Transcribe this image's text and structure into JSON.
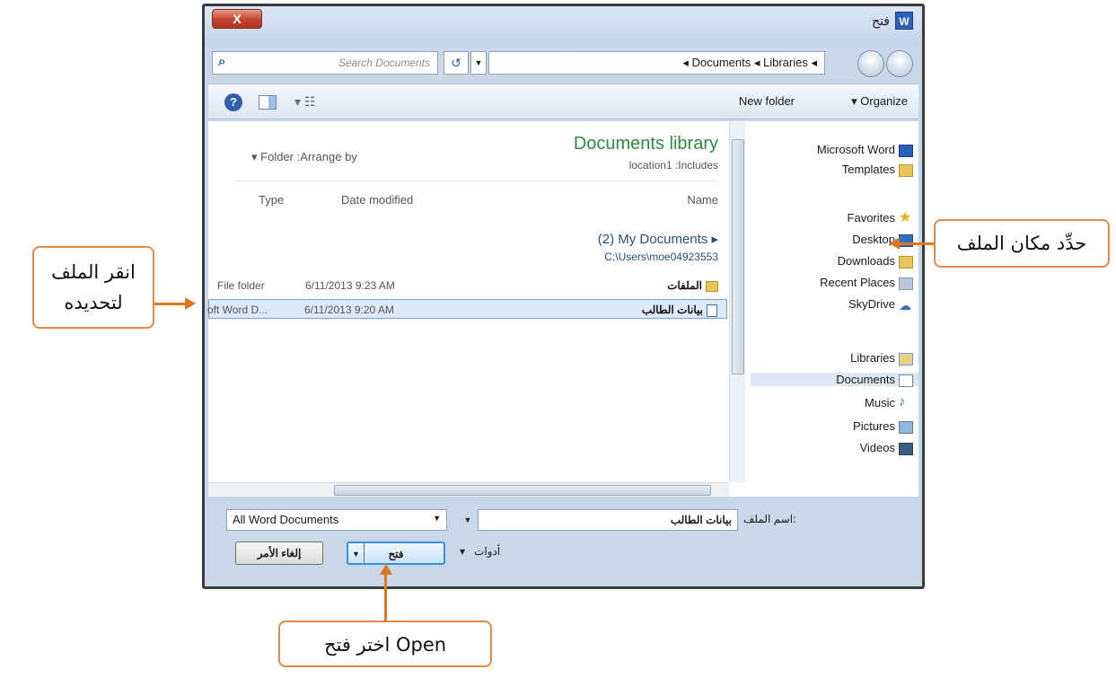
{
  "window": {
    "title": "فتح",
    "close_label": "X",
    "app_icon_letter": "W"
  },
  "address_bar": {
    "search_placeholder": "Search Documents",
    "breadcrumb": "◂ Documents ◂ Libraries ◂"
  },
  "toolbar": {
    "new_folder": "New folder",
    "organize": "▾ Organize"
  },
  "file_pane": {
    "arrange_by": "▾ Folder   :Arrange by",
    "library_title": "Documents library",
    "library_includes": "location1  :Includes",
    "columns": {
      "type": "Type",
      "date_modified": "Date modified",
      "name": "Name"
    },
    "group": {
      "title": "(2) My Documents ▸",
      "path": "C:\\Users\\moe04923553"
    },
    "rows": [
      {
        "type": "File folder",
        "date": "6/11/2013 9:23 AM",
        "name": "الملفات"
      },
      {
        "type": "oft Word D...",
        "date": "6/11/2013 9:20 AM",
        "name": "بيانات الطالب"
      }
    ]
  },
  "nav_pane": {
    "items": [
      {
        "label": "Microsoft Word"
      },
      {
        "label": "Templates"
      },
      {
        "label": "Favorites"
      },
      {
        "label": "Desktop"
      },
      {
        "label": "Downloads"
      },
      {
        "label": "Recent Places"
      },
      {
        "label": "SkyDrive"
      },
      {
        "label": "Libraries"
      },
      {
        "label": "Documents"
      },
      {
        "label": "Music"
      },
      {
        "label": "Pictures"
      },
      {
        "label": "Videos"
      }
    ]
  },
  "bottom": {
    "file_type": "All Word Documents",
    "file_name_label": "اسم الملف:",
    "file_name": "بيانات الطالب",
    "tools": "أدوات",
    "open": "فتح",
    "cancel": "إلغاء الأمر"
  },
  "callouts": {
    "click_file_line1": "انقر الملف",
    "click_file_line2": "لتحديده",
    "choose_location": "حدِّد مكان الملف",
    "choose_open": "اختر فتح Open"
  },
  "colors": {
    "window_frame": "#c9d8e9",
    "library_title": "#2f8a3a",
    "callout_border": "#e08a4a",
    "arrow": "#e0761e",
    "selection": "#dbe9f9"
  }
}
